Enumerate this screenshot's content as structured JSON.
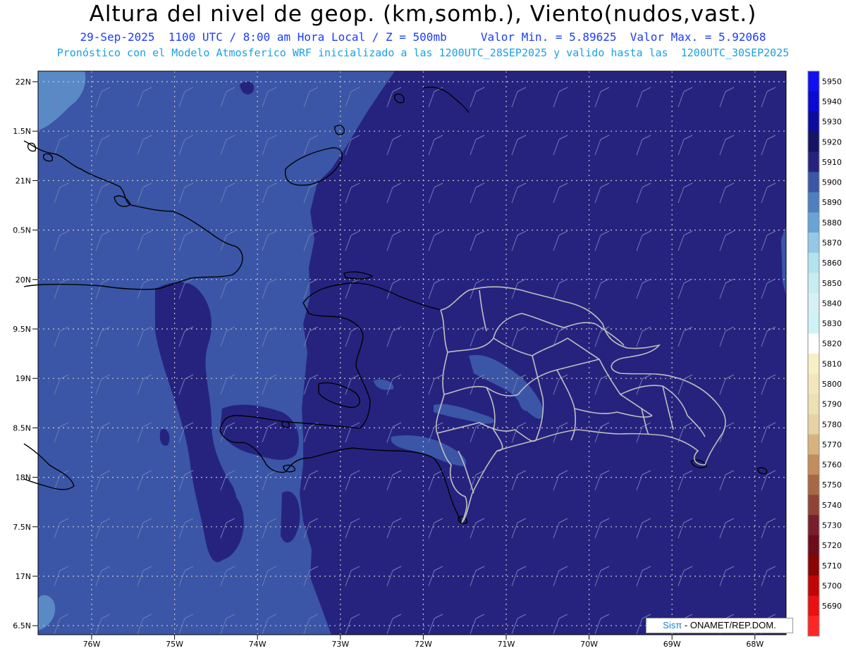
{
  "header": {
    "title": "Altura del nivel de geop. (km,somb.), Viento(nudos,vast.)",
    "subtitle": "29-Sep-2025  1100 UTC / 8:00 am Hora Local / Z = 500mb     Valor Min. = 5.89625  Valor Max. = 5.92068",
    "forecast_line": "Pronóstico con el Modelo Atmosferico WRF inicializado a las 1200UTC_28SEP2025 y valido hasta las  1200UTC_30SEP2025"
  },
  "map": {
    "lat_labels": [
      "22N",
      "1.5N",
      "21N",
      "0.5N",
      "20N",
      "9.5N",
      "19N",
      "8.5N",
      "18N",
      "7.5N",
      "17N",
      "6.5N"
    ],
    "lon_labels": [
      "76W",
      "75W",
      "74W",
      "73W",
      "72W",
      "71W",
      "70W",
      "69W",
      "68W"
    ],
    "colors": {
      "deep_field": "#26237f",
      "mid_field": "#3b56a6",
      "light_field": "#5a8ac6",
      "coast": "#000000",
      "borders": "#bdbdbd",
      "grid": "#c8c8c8"
    }
  },
  "colorbar": {
    "levels": [
      "5950",
      "5940",
      "5930",
      "5920",
      "5910",
      "5900",
      "5890",
      "5880",
      "5870",
      "5860",
      "5850",
      "5840",
      "5830",
      "5820",
      "5810",
      "5800",
      "5790",
      "5780",
      "5770",
      "5760",
      "5750",
      "5740",
      "5730",
      "5720",
      "5710",
      "5700",
      "5690"
    ],
    "colors": [
      "#1010f0",
      "#0a0ad2",
      "#0c0c9c",
      "#151465",
      "#26237f",
      "#3b56a6",
      "#4f7fbf",
      "#6aa3d6",
      "#94c8e6",
      "#b4e1ee",
      "#c9ebf2",
      "#d6f0f5",
      "#cdf3f6",
      "#ffffff",
      "#f7efc6",
      "#f3e6bc",
      "#ede0b4",
      "#e7d2a6",
      "#d7b27f",
      "#c48d5c",
      "#a86845",
      "#8e4336",
      "#7a1e2e",
      "#6e0c1b",
      "#8a0404",
      "#c00606",
      "#e81212",
      "#ff2626"
    ]
  },
  "credit": {
    "logo": "Sisπ",
    "text": " - ONAMET/REP.DOM."
  }
}
